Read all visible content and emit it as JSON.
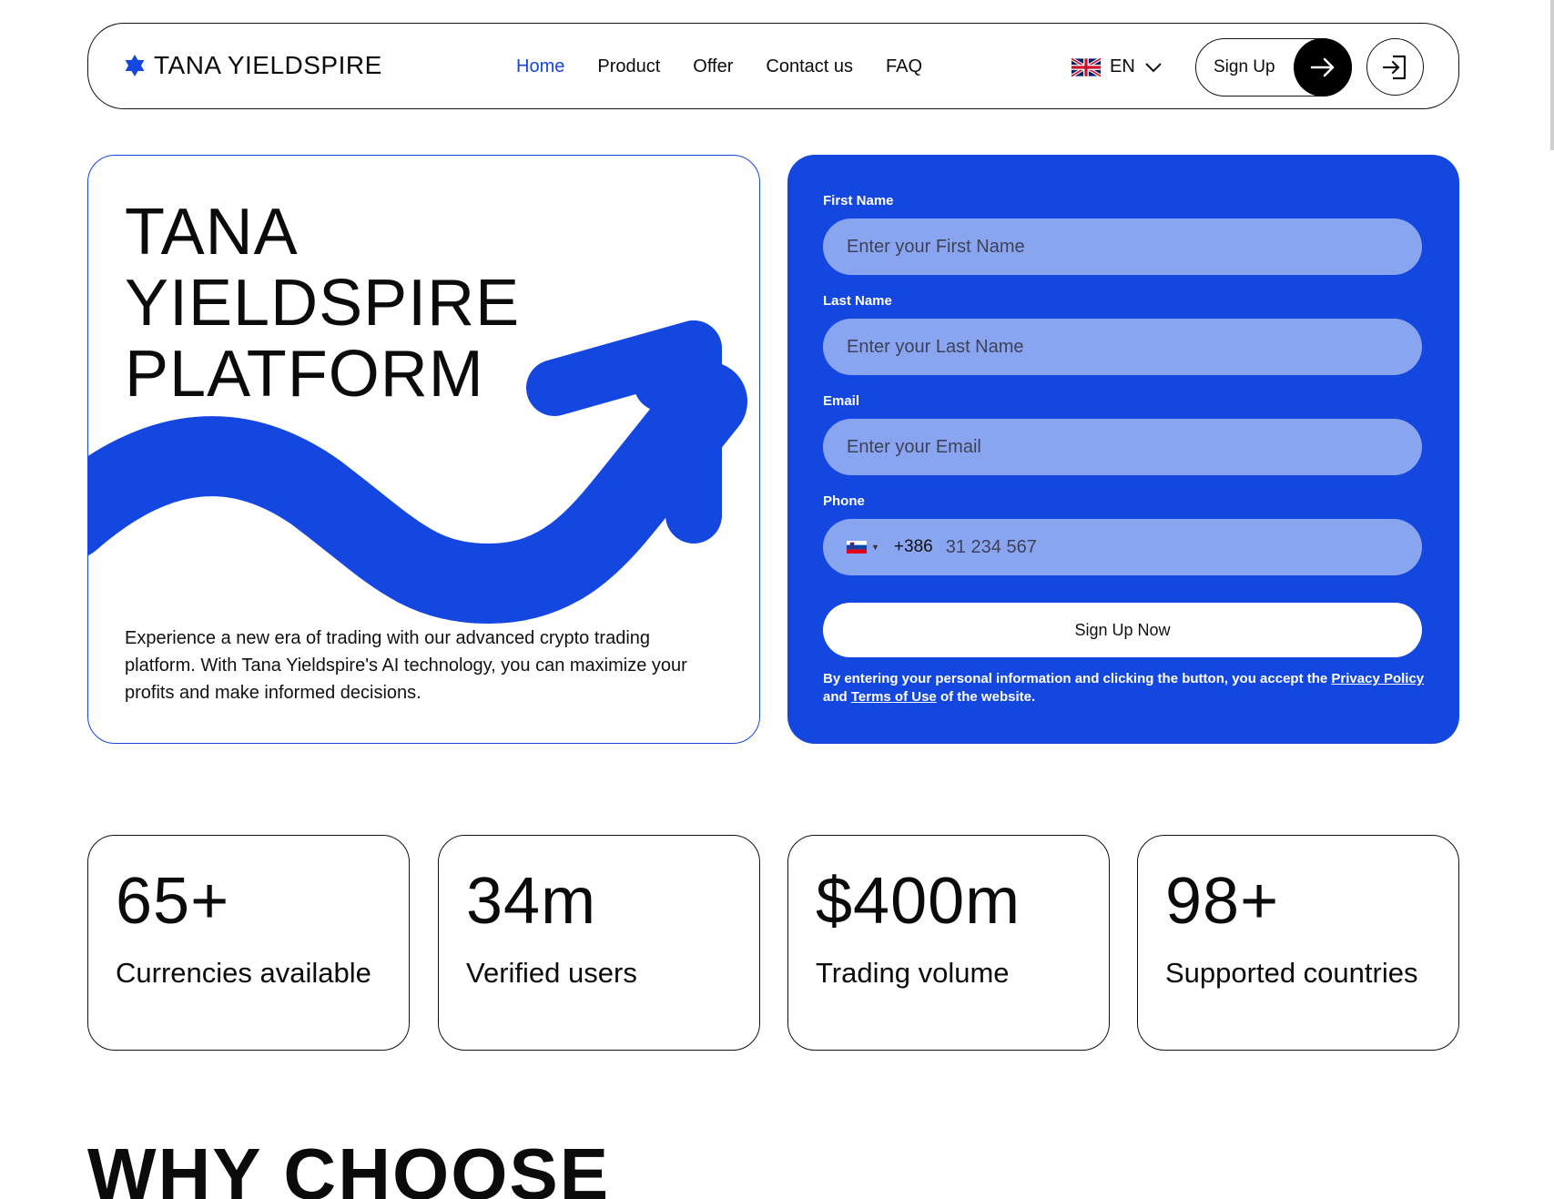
{
  "header": {
    "logo_text": "TANA YIELDSPIRE",
    "nav": [
      "Home",
      "Product",
      "Offer",
      "Contact us",
      "FAQ"
    ],
    "language": "EN",
    "signup_label": "Sign Up"
  },
  "hero": {
    "title_lines": [
      "TANA",
      "YIELDSPIRE",
      "PLATFORM"
    ],
    "description": "Experience a new era of trading with our advanced crypto trading platform. With Tana Yieldspire's AI technology, you can maximize your profits and make informed decisions."
  },
  "form": {
    "first_name_label": "First Name",
    "first_name_placeholder": "Enter your First Name",
    "last_name_label": "Last Name",
    "last_name_placeholder": "Enter your Last Name",
    "email_label": "Email",
    "email_placeholder": "Enter your Email",
    "phone_label": "Phone",
    "phone_code": "+386",
    "phone_placeholder": "31 234 567",
    "submit_label": "Sign Up Now",
    "legal_prefix": "By entering your personal information and clicking the button, you accept the",
    "privacy_link": "Privacy Policy",
    "legal_and": "and",
    "terms_link": "Terms of Use",
    "legal_suffix": "of the website."
  },
  "stats": [
    {
      "value": "65+",
      "label": "Currencies available"
    },
    {
      "value": "34m",
      "label": "Verified users"
    },
    {
      "value": "$400m",
      "label": "Trading volume"
    },
    {
      "value": "98+",
      "label": "Supported countries"
    }
  ],
  "section_heading": "WHY CHOOSE",
  "colors": {
    "accent": "#1447e0",
    "field_bg": "#8aa5f0",
    "text": "#0b0b0b"
  }
}
